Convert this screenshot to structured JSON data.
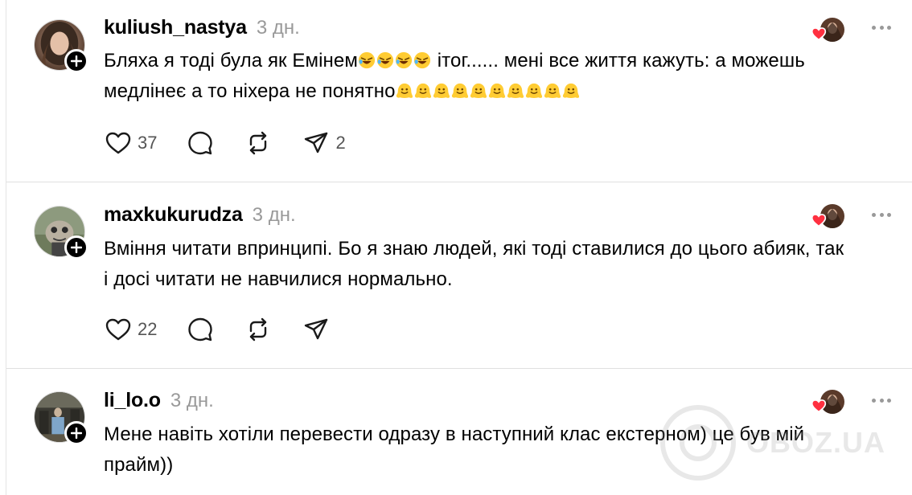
{
  "posts": [
    {
      "username": "kuliush_nastya",
      "time": "3 дн.",
      "text": "Бляха я тоді була як Емінем",
      "text_after_emojis": " ітог...... мені все життя кажуть: а можешь медлінеє а то ніхера не понятно",
      "emoji_inline": [
        "rofl",
        "rofl",
        "rofl",
        "rofl"
      ],
      "emoji_trailing": [
        "melting-face",
        "melting-face",
        "melting-face",
        "melting-face",
        "melting-face",
        "melting-face",
        "melting-face",
        "melting-face",
        "melting-face",
        "melting-face"
      ],
      "likes": "37",
      "shares": "2"
    },
    {
      "username": "maxkukurudza",
      "time": "3 дн.",
      "text": "Вміння читати впринципі. Бо я знаю людей, які тоді ставилися до цього абияк, так і досі читати не навчилися нормально.",
      "likes": "22",
      "shares": ""
    },
    {
      "username": "li_lo.o",
      "time": "3 дн.",
      "text": "Мене навіть хотіли перевести одразу в наступний клас екстерном) це був мій прайм))"
    }
  ],
  "watermark": {
    "text": "OBOZ.UA"
  },
  "icons": {
    "like": "heart-outline-icon",
    "reply": "speech-bubble-icon",
    "repost": "repost-arrows-icon",
    "share": "paper-plane-icon",
    "more": "more-dots-icon",
    "follow": "plus-icon",
    "liked_by_heart": "red-heart-icon"
  },
  "colors": {
    "liked_heart": "#ff3040",
    "muted": "#999999",
    "divider": "#e0e0e0"
  }
}
